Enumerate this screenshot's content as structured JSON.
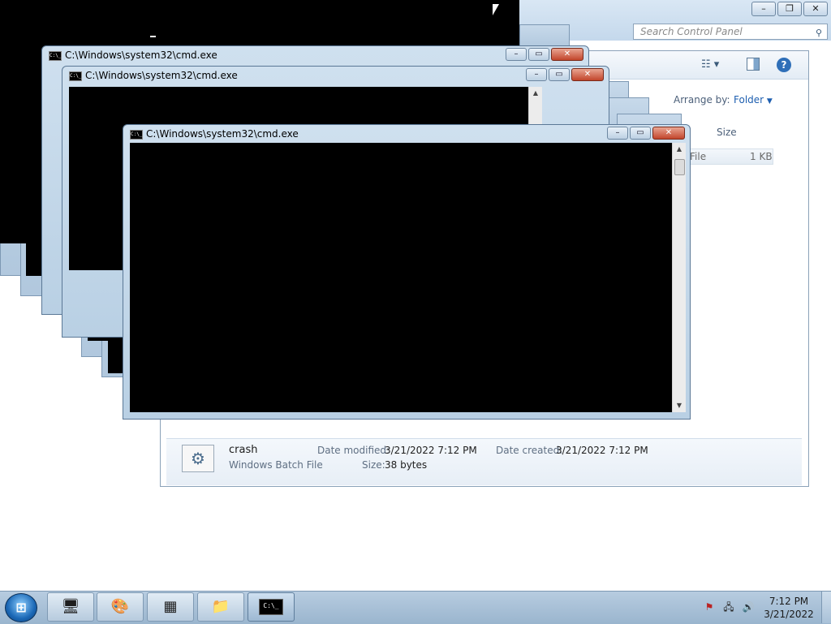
{
  "explorer": {
    "search_placeholder": "Search Control Panel",
    "arrange_label": "Arrange by:",
    "arrange_value": "Folder",
    "column_size": "Size",
    "file_type_partial": "File",
    "file_size": "1 KB",
    "details": {
      "name": "crash",
      "type": "Windows Batch File",
      "date_modified_label": "Date modified:",
      "date_modified": "3/21/2022 7:12 PM",
      "size_label": "Size:",
      "size": "38 bytes",
      "date_created_label": "Date created:",
      "date_created": "3/21/2022 7:12 PM"
    }
  },
  "cmd_windows": [
    {
      "title": "C:\\Windows\\system32\\cmd.exe"
    },
    {
      "title": "C:\\Windows\\system32\\cmd.exe"
    },
    {
      "title": "C:\\Windows\\system32\\cmd.exe"
    }
  ],
  "taskbar": {
    "time": "7:12 PM",
    "date": "3/21/2022",
    "buttons": [
      "remote-desktop",
      "paint",
      "control-panel",
      "windows-explorer",
      "command-prompt"
    ]
  },
  "icons": {
    "console": "C:\\_"
  }
}
